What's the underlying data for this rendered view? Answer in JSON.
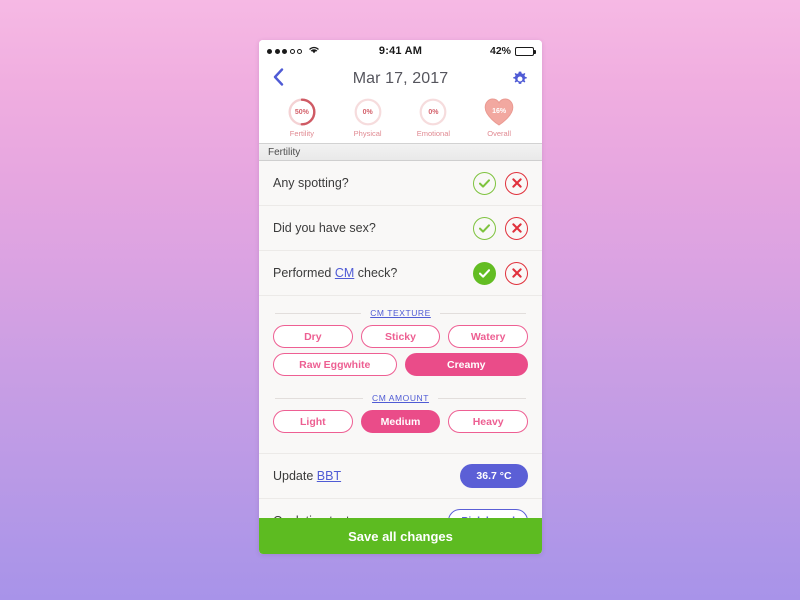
{
  "status_bar": {
    "signal_filled": 3,
    "signal_empty": 2,
    "wifi_icon": "wifi-icon",
    "time": "9:41 AM",
    "battery_percent": "42%",
    "battery_level": 42
  },
  "nav": {
    "back_icon": "chevron-left-icon",
    "title": "Mar 17, 2017",
    "settings_icon": "gear-icon"
  },
  "stats": [
    {
      "value": "50%",
      "label": "Fertility",
      "percent": 50,
      "type": "ring"
    },
    {
      "value": "0%",
      "label": "Physical",
      "percent": 0,
      "type": "ring"
    },
    {
      "value": "0%",
      "label": "Emotional",
      "percent": 0,
      "type": "ring"
    },
    {
      "value": "16%",
      "label": "Overall",
      "percent": 16,
      "type": "heart"
    }
  ],
  "section": {
    "header": "Fertility"
  },
  "questions": [
    {
      "text": "Any spotting?",
      "link": null,
      "text_after": null,
      "yes_selected": false,
      "no_selected": false
    },
    {
      "text": "Did you have sex?",
      "link": null,
      "text_after": null,
      "yes_selected": false,
      "no_selected": false
    },
    {
      "text": "Performed ",
      "link": "CM",
      "text_after": " check?",
      "yes_selected": true,
      "no_selected": false
    }
  ],
  "cm_texture": {
    "label": "CM TEXTURE",
    "options": [
      {
        "label": "Dry",
        "selected": false
      },
      {
        "label": "Sticky",
        "selected": false
      },
      {
        "label": "Watery",
        "selected": false
      },
      {
        "label": "Raw Eggwhite",
        "selected": false
      },
      {
        "label": "Creamy",
        "selected": true
      }
    ]
  },
  "cm_amount": {
    "label": "CM AMOUNT",
    "options": [
      {
        "label": "Light",
        "selected": false
      },
      {
        "label": "Medium",
        "selected": true
      },
      {
        "label": "Heavy",
        "selected": false
      }
    ]
  },
  "value_rows": [
    {
      "text": "Update ",
      "link": "BBT",
      "text_after": "",
      "pill_label": "36.7 °C",
      "pill_style": "filled"
    },
    {
      "text": "Ovulation test",
      "link": null,
      "text_after": null,
      "pill_label": "Pick brand",
      "pill_style": "outlined"
    }
  ],
  "save_bar": {
    "label": "Save all changes"
  },
  "colors": {
    "accent_pink": "#ea4c89",
    "pink_outline": "#ee5f93",
    "indigo": "#5b5fd6",
    "link_blue": "#4f5bd5",
    "green": "#63bd23",
    "save_green": "#5dbb21",
    "red": "#e0313c",
    "ring_red": "#d4616b",
    "bg_top": "#f6b9e4",
    "bg_bottom": "#a893e9"
  }
}
